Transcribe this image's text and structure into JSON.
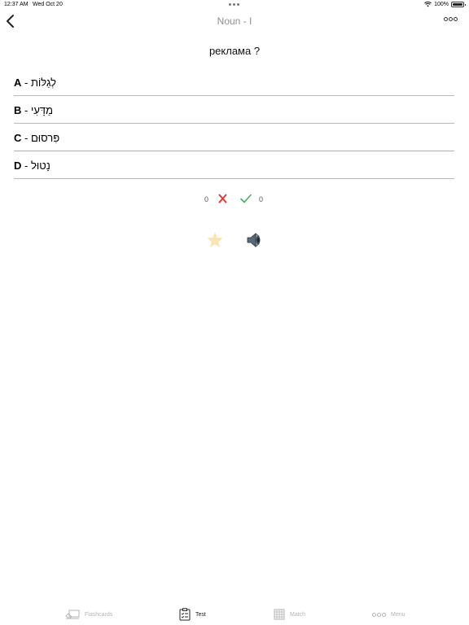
{
  "status_bar": {
    "time": "12:37 AM",
    "date": "Wed Oct 20",
    "battery": "100%"
  },
  "nav": {
    "title": "Noun - I"
  },
  "question": "реклама ?",
  "answers": [
    {
      "letter": "A",
      "text": "לְגַלּוֹת",
      "line_color": "#84d2d8"
    },
    {
      "letter": "B",
      "text": "מַדָּעִי",
      "line_color": "#f2a0a0"
    },
    {
      "letter": "C",
      "text": "פִּרסוּם",
      "line_color": "#6fcfae"
    },
    {
      "letter": "D",
      "text": "נָטוּל",
      "line_color": "#f2a0a0"
    }
  ],
  "score": {
    "wrong": "0",
    "correct": "0",
    "wrong_color": "#e53935",
    "correct_color": "#43b05c"
  },
  "tabs": [
    {
      "label": "Flashcards",
      "icon": "flashcards-icon",
      "active": false
    },
    {
      "label": "Test",
      "icon": "test-clipboard-icon",
      "active": true
    },
    {
      "label": "Match",
      "icon": "match-grid-icon",
      "active": false
    },
    {
      "label": "Menu",
      "icon": "menu-dots-icon",
      "active": false
    }
  ]
}
